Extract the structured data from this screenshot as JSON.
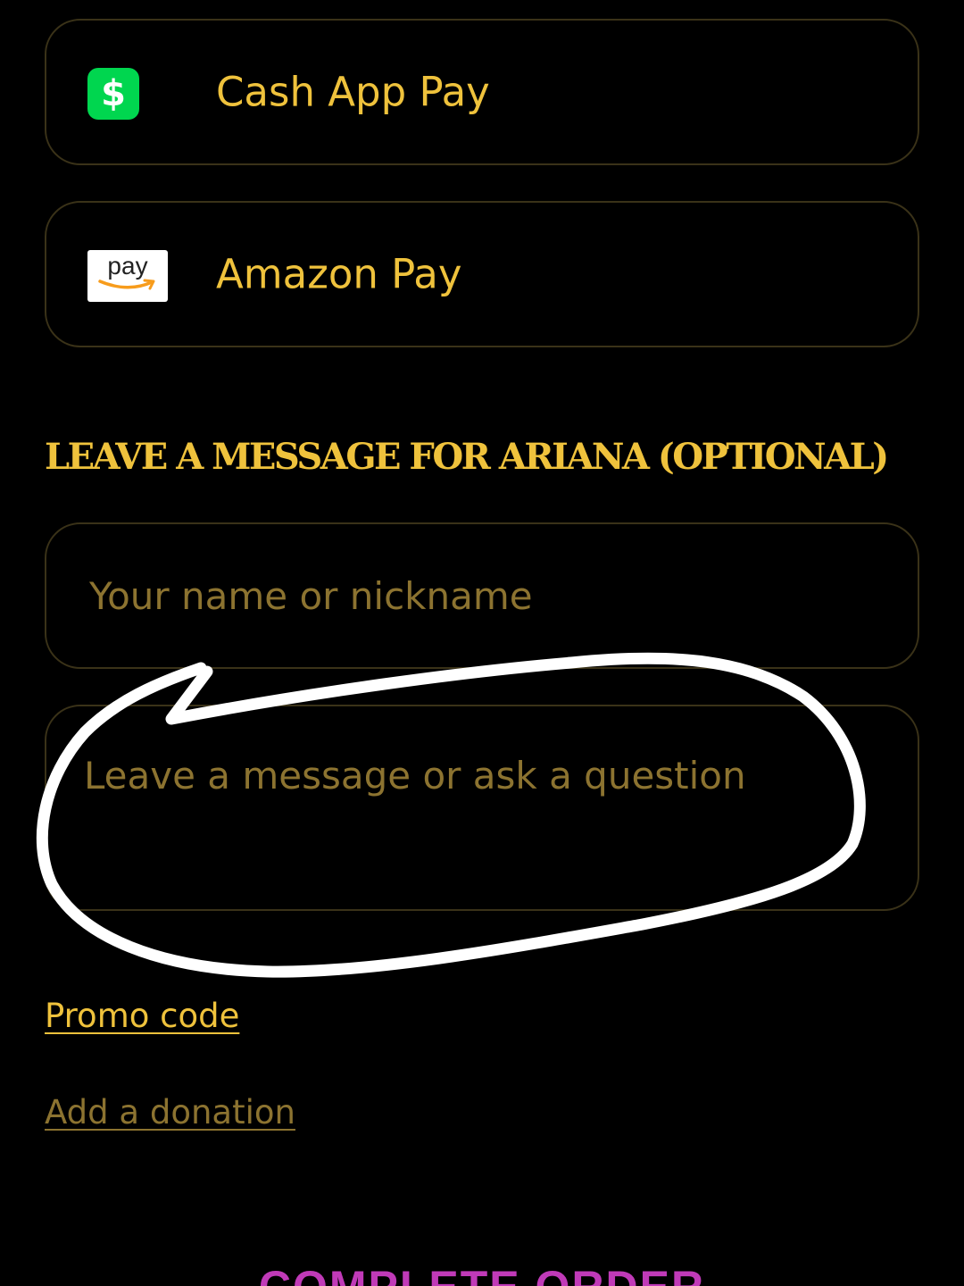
{
  "payment_options": [
    {
      "label": "Cash App Pay",
      "icon": "cash-app-icon",
      "icon_glyph": "$",
      "icon_color": "#00d64f"
    },
    {
      "label": "Amazon Pay",
      "icon": "amazon-pay-icon",
      "icon_text": "pay",
      "smile_color": "#f79c1c"
    }
  ],
  "message_section": {
    "heading": "LEAVE A MESSAGE FOR ARIANA (OPTIONAL)",
    "name_placeholder": "Your name or nickname",
    "message_placeholder": "Leave a message or ask a question"
  },
  "links": {
    "promo": "Promo code",
    "donation": "Add a donation"
  },
  "submit": {
    "label": "COMPLETE ORDER"
  },
  "annotation": {
    "type": "hand-drawn-circle",
    "color": "#ffffff"
  },
  "colors": {
    "background": "#000000",
    "accent": "#efc23c",
    "muted_accent": "#8c7330",
    "border": "#3a3218",
    "submit": "#c03ab8"
  }
}
